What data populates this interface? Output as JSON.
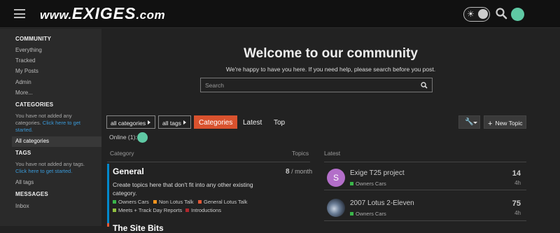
{
  "header": {
    "logo_prefix": "www.",
    "logo_brand": "EXIGES",
    "logo_suffix": ".com"
  },
  "sidebar": {
    "community_heading": "COMMUNITY",
    "community_items": [
      "Everything",
      "Tracked",
      "My Posts",
      "Admin",
      "More..."
    ],
    "categories_heading": "CATEGORIES",
    "categories_text": "You have not added any categories. ",
    "categories_link": "Click here to get started.",
    "all_categories": "All categories",
    "tags_heading": "TAGS",
    "tags_text": "You have not added any tags. ",
    "tags_link": "Click here to get started.",
    "all_tags": "All tags",
    "messages_heading": "MESSAGES",
    "inbox": "Inbox"
  },
  "welcome": {
    "title": "Welcome to our community",
    "subtitle": "We're happy to have you here. If you need help, please search before you post.",
    "search_placeholder": "Search"
  },
  "toolbar": {
    "categories_dropdown": "all categories",
    "tags_dropdown": "all tags",
    "nav": [
      "Categories",
      "Latest",
      "Top"
    ],
    "new_topic": "New Topic"
  },
  "online": "Online (1):",
  "columns": {
    "category": "Category",
    "topics": "Topics",
    "latest": "Latest"
  },
  "category": {
    "name": "General",
    "description": "Create topics here that don't fit into any other existing category.",
    "count": "8",
    "per": " / month",
    "subcategories": [
      {
        "label": "Owners Cars",
        "color": "#3ab54a"
      },
      {
        "label": "Non Lotus Talk",
        "color": "#f7941d"
      },
      {
        "label": "General Lotus Talk",
        "color": "#e45735"
      },
      {
        "label": "Meets + Track Day Reports",
        "color": "#92c13f"
      },
      {
        "label": "Introductions",
        "color": "#b3272d"
      }
    ],
    "next_name": "The Site Bits"
  },
  "latest": [
    {
      "title": "Exige T25 project",
      "category": "Owners Cars",
      "count": "14",
      "time": "4h",
      "avatar_letter": "S",
      "avatar_color": "#b36ec9"
    },
    {
      "title": "2007 Lotus 2-Eleven",
      "category": "Owners Cars",
      "count": "75",
      "time": "4h",
      "avatar_letter": "",
      "avatar_color": "#4a5a72"
    }
  ]
}
